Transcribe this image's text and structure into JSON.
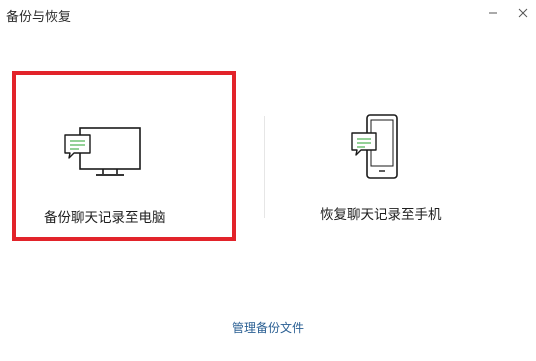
{
  "window": {
    "title": "备份与恢复",
    "minimize_icon": "minimize-icon",
    "close_icon": "close-icon"
  },
  "options": {
    "backup": {
      "label": "备份聊天记录至电脑",
      "icon": "monitor-chat-icon",
      "selected": true
    },
    "restore": {
      "label": "恢复聊天记录至手机",
      "icon": "phone-chat-icon",
      "selected": false
    }
  },
  "footer": {
    "manage_link": "管理备份文件"
  },
  "colors": {
    "selection_border": "#e2232a",
    "link": "#2a5f93",
    "chat_bubble_lines": "#5ab85f",
    "icon_stroke": "#1a1a1a"
  }
}
